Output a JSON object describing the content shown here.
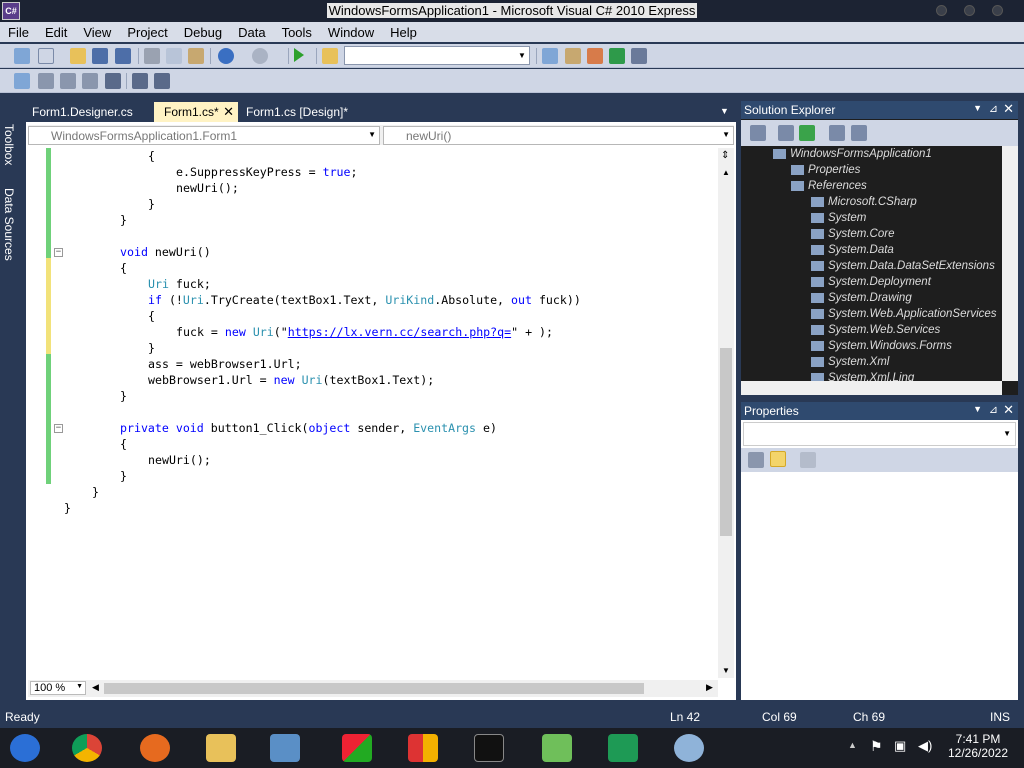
{
  "window": {
    "title": "WindowsFormsApplication1 - Microsoft Visual C# 2010 Express",
    "app_icon": "C#"
  },
  "menu": [
    "File",
    "Edit",
    "View",
    "Project",
    "Debug",
    "Data",
    "Tools",
    "Window",
    "Help"
  ],
  "sidebar": {
    "toolbox": "Toolbox",
    "data_sources": "Data Sources"
  },
  "tabs": [
    {
      "label": "Form1.Designer.cs",
      "active": false
    },
    {
      "label": "Form1.cs*",
      "active": true
    },
    {
      "label": "Form1.cs [Design]*",
      "active": false
    }
  ],
  "nav": {
    "class_combo": "WindowsFormsApplication1.Form1",
    "member_combo": "newUri()"
  },
  "code": [
    {
      "indent": 3,
      "spans": [
        [
          "p",
          "{"
        ]
      ]
    },
    {
      "indent": 4,
      "spans": [
        [
          "p",
          "e.SuppressKeyPress = "
        ],
        [
          "kw",
          "true"
        ],
        [
          "p",
          ";"
        ]
      ]
    },
    {
      "indent": 4,
      "spans": [
        [
          "p",
          "newUri();"
        ]
      ]
    },
    {
      "indent": 3,
      "spans": [
        [
          "p",
          "}"
        ]
      ]
    },
    {
      "indent": 2,
      "spans": [
        [
          "p",
          "}"
        ]
      ]
    },
    {
      "indent": 2,
      "spans": []
    },
    {
      "indent": 2,
      "spans": [
        [
          "kw",
          "void"
        ],
        [
          "p",
          " newUri()"
        ]
      ]
    },
    {
      "indent": 2,
      "spans": [
        [
          "p",
          "{"
        ]
      ]
    },
    {
      "indent": 3,
      "spans": [
        [
          "ty",
          "Uri"
        ],
        [
          "p",
          " fuck;"
        ]
      ]
    },
    {
      "indent": 3,
      "spans": [
        [
          "kw",
          "if"
        ],
        [
          "p",
          " (!"
        ],
        [
          "ty",
          "Uri"
        ],
        [
          "p",
          ".TryCreate(textBox1.Text, "
        ],
        [
          "ty",
          "UriKind"
        ],
        [
          "p",
          ".Absolute, "
        ],
        [
          "kw",
          "out"
        ],
        [
          "p",
          " fuck))"
        ]
      ]
    },
    {
      "indent": 3,
      "spans": [
        [
          "p",
          "{"
        ]
      ]
    },
    {
      "indent": 4,
      "spans": [
        [
          "p",
          "fuck = "
        ],
        [
          "kw",
          "new"
        ],
        [
          "p",
          " "
        ],
        [
          "ty",
          "Uri"
        ],
        [
          "p",
          "(\""
        ],
        [
          "url",
          "https://lx.vern.cc/search.php?q="
        ],
        [
          "p",
          "\" + );"
        ]
      ]
    },
    {
      "indent": 3,
      "spans": [
        [
          "p",
          "}"
        ]
      ]
    },
    {
      "indent": 3,
      "spans": [
        [
          "p",
          "ass = webBrowser1.Url;"
        ]
      ]
    },
    {
      "indent": 3,
      "spans": [
        [
          "p",
          "webBrowser1.Url = "
        ],
        [
          "kw",
          "new"
        ],
        [
          "p",
          " "
        ],
        [
          "ty",
          "Uri"
        ],
        [
          "p",
          "(textBox1.Text);"
        ]
      ]
    },
    {
      "indent": 2,
      "spans": [
        [
          "p",
          "}"
        ]
      ]
    },
    {
      "indent": 2,
      "spans": []
    },
    {
      "indent": 2,
      "spans": [
        [
          "kw",
          "private void"
        ],
        [
          "p",
          " button1_Click("
        ],
        [
          "kw",
          "object"
        ],
        [
          "p",
          " sender, "
        ],
        [
          "ty",
          "EventArgs"
        ],
        [
          "p",
          " e)"
        ]
      ]
    },
    {
      "indent": 2,
      "spans": [
        [
          "p",
          "{"
        ]
      ]
    },
    {
      "indent": 3,
      "spans": [
        [
          "p",
          "newUri();"
        ]
      ]
    },
    {
      "indent": 2,
      "spans": [
        [
          "p",
          "}"
        ]
      ]
    },
    {
      "indent": 1,
      "spans": [
        [
          "p",
          "}"
        ]
      ]
    },
    {
      "indent": 0,
      "spans": [
        [
          "p",
          "}"
        ]
      ]
    }
  ],
  "zoom": "100 %",
  "solution_explorer": {
    "title": "Solution Explorer",
    "items": [
      {
        "label": "WindowsFormsApplication1",
        "level": 0
      },
      {
        "label": "Properties",
        "level": 1
      },
      {
        "label": "References",
        "level": 1
      },
      {
        "label": "Microsoft.CSharp",
        "level": 2
      },
      {
        "label": "System",
        "level": 2
      },
      {
        "label": "System.Core",
        "level": 2
      },
      {
        "label": "System.Data",
        "level": 2
      },
      {
        "label": "System.Data.DataSetExtensions",
        "level": 2
      },
      {
        "label": "System.Deployment",
        "level": 2
      },
      {
        "label": "System.Drawing",
        "level": 2
      },
      {
        "label": "System.Web.ApplicationServices",
        "level": 2
      },
      {
        "label": "System.Web.Services",
        "level": 2
      },
      {
        "label": "System.Windows.Forms",
        "level": 2
      },
      {
        "label": "System.Xml",
        "level": 2
      },
      {
        "label": "System.Xml.Linq",
        "level": 2
      }
    ]
  },
  "properties": {
    "title": "Properties"
  },
  "status": {
    "text": "Ready",
    "ln": "Ln 42",
    "col": "Col 69",
    "ch": "Ch 69",
    "ins": "INS"
  },
  "clock": {
    "time": "7:41 PM",
    "date": "12/26/2022"
  },
  "taskbar_apps": [
    "chromium-icon",
    "chrome-icon",
    "firefox-icon",
    "file-manager-icon",
    "network-icon",
    "winxp-flag-icon",
    "office-icon",
    "terminal-icon",
    "notepad-icon",
    "csharp-icon",
    "paint-icon"
  ]
}
